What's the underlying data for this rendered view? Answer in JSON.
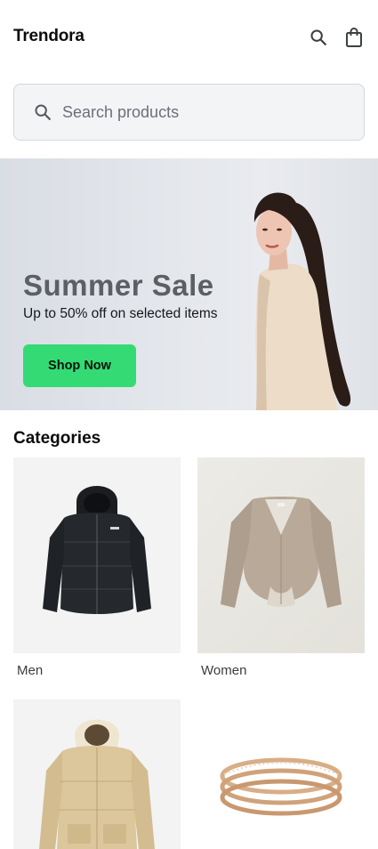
{
  "header": {
    "brand": "Trendora",
    "icons": [
      "search-icon",
      "shopping-bag-icon"
    ]
  },
  "search": {
    "placeholder": "Search products",
    "value": "",
    "icon": "search-icon"
  },
  "hero": {
    "title": "Summer Sale",
    "subtitle": "Up to 50% off on selected items",
    "cta_label": "Shop Now",
    "cta_color": "#34db74"
  },
  "categories": {
    "title": "Categories",
    "items": [
      {
        "label": "Men",
        "image": "black puffer jacket"
      },
      {
        "label": "Women",
        "image": "beige cardigan"
      },
      {
        "label": "",
        "image": "beige hooded puffer jacket"
      },
      {
        "label": "",
        "image": "gold ring"
      }
    ]
  },
  "colors": {
    "accent": "#34db74",
    "text": "#0b0b0b",
    "hero_title": "#5c5f64"
  }
}
